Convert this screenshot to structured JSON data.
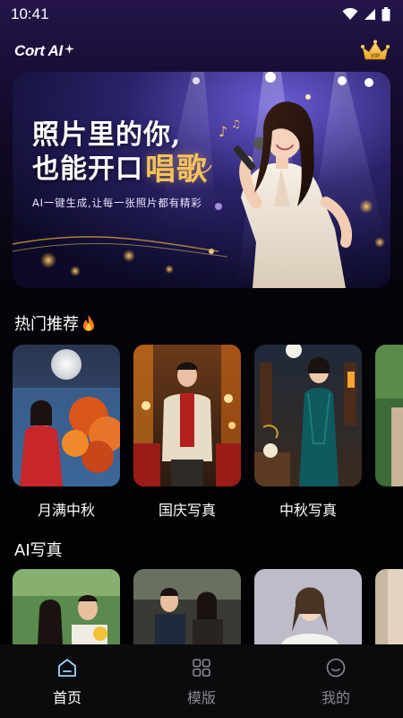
{
  "status_bar": {
    "time": "10:41",
    "icons": [
      "wifi-icon",
      "signal-icon",
      "battery-icon"
    ]
  },
  "header": {
    "logo": "Cort AI",
    "logo_icon": "sparkle-icon",
    "vip_badge": "VIP",
    "vip_icon": "crown-icon"
  },
  "banner": {
    "line1": "照片里的你,",
    "line2": "也能开口",
    "line2_accent": "唱歌",
    "subtitle": "AI一键生成,让每一张照片都有精彩"
  },
  "sections": {
    "hot": {
      "title": "热门推荐",
      "icon": "fire-icon"
    },
    "ai": {
      "title": "AI写真"
    }
  },
  "hot_items": [
    {
      "label": "月满中秋"
    },
    {
      "label": "国庆写真"
    },
    {
      "label": "中秋写真"
    },
    {
      "label": ""
    }
  ],
  "nav": {
    "items": [
      {
        "label": "首页",
        "icon": "home-icon",
        "active": true
      },
      {
        "label": "模版",
        "icon": "grid-icon",
        "active": false
      },
      {
        "label": "我的",
        "icon": "smile-icon",
        "active": false
      }
    ]
  },
  "colors": {
    "accent_gold": "#f4c15c",
    "header_purple": "#25154a",
    "background": "#000000",
    "inactive_text": "#8a8a90"
  }
}
